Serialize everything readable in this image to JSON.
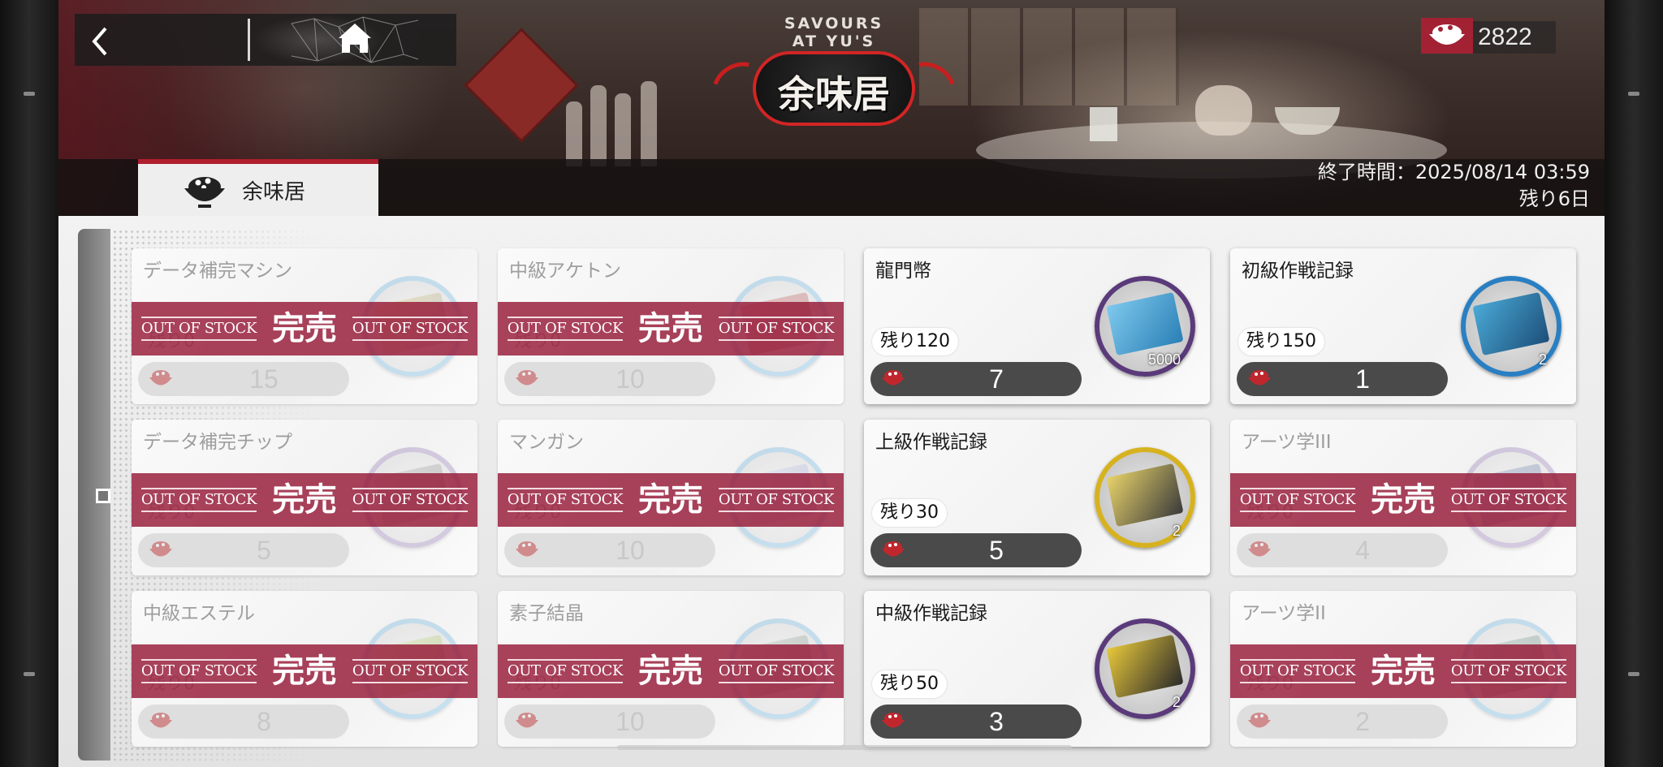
{
  "header": {
    "logo_subtitle": "SAVOURS AT YU'S",
    "logo_title": "余味居",
    "currency": {
      "icon": "rice-bowl-icon",
      "value": "2822"
    }
  },
  "nav": {
    "back_icon": "chevron-left-icon",
    "home_icon": "home-icon"
  },
  "tab": {
    "label": "余味居",
    "icon": "rice-bowl-icon"
  },
  "end_time": {
    "line1": "終了時間：2025/08/14 03:59",
    "line2": "残り6日"
  },
  "sold_label": {
    "en": "OUT OF STOCK",
    "jp": "完売"
  },
  "colors": {
    "accent": "#b01e2e",
    "sold_band": "#96193a",
    "price_bar": "#4a4a4a"
  },
  "items": [
    {
      "name": "データ補完マシン",
      "stock": "残り0",
      "price": "15",
      "qty": "",
      "sold_out": true,
      "icon": "data-machine-icon"
    },
    {
      "name": "中級アケトン",
      "stock": "残り0",
      "price": "10",
      "qty": "",
      "sold_out": true,
      "icon": "ketone-icon"
    },
    {
      "name": "龍門幣",
      "stock": "残り120",
      "price": "7",
      "qty": "5000",
      "sold_out": false,
      "icon": "lmd-icon"
    },
    {
      "name": "初級作戦記録",
      "stock": "残り150",
      "price": "1",
      "qty": "2",
      "sold_out": false,
      "icon": "drill-battle-record-icon"
    },
    {
      "name": "データ補完チップ",
      "stock": "残り0",
      "price": "5",
      "qty": "",
      "sold_out": true,
      "icon": "data-chip-icon"
    },
    {
      "name": "マンガン",
      "stock": "残り0",
      "price": "10",
      "qty": "",
      "sold_out": true,
      "icon": "manganese-icon"
    },
    {
      "name": "上級作戦記録",
      "stock": "残り30",
      "price": "5",
      "qty": "2",
      "sold_out": false,
      "icon": "strategic-battle-record-icon"
    },
    {
      "name": "アーツ学III",
      "stock": "残り0",
      "price": "4",
      "qty": "",
      "sold_out": true,
      "icon": "skill-summary-3-icon"
    },
    {
      "name": "中級エステル",
      "stock": "残り0",
      "price": "8",
      "qty": "",
      "sold_out": true,
      "icon": "ester-icon"
    },
    {
      "name": "素子結晶",
      "stock": "残り0",
      "price": "10",
      "qty": "",
      "sold_out": true,
      "icon": "crystal-component-icon"
    },
    {
      "name": "中級作戦記録",
      "stock": "残り50",
      "price": "3",
      "qty": "2",
      "sold_out": false,
      "icon": "tactical-battle-record-icon"
    },
    {
      "name": "アーツ学II",
      "stock": "残り0",
      "price": "2",
      "qty": "",
      "sold_out": true,
      "icon": "skill-summary-2-icon"
    }
  ]
}
